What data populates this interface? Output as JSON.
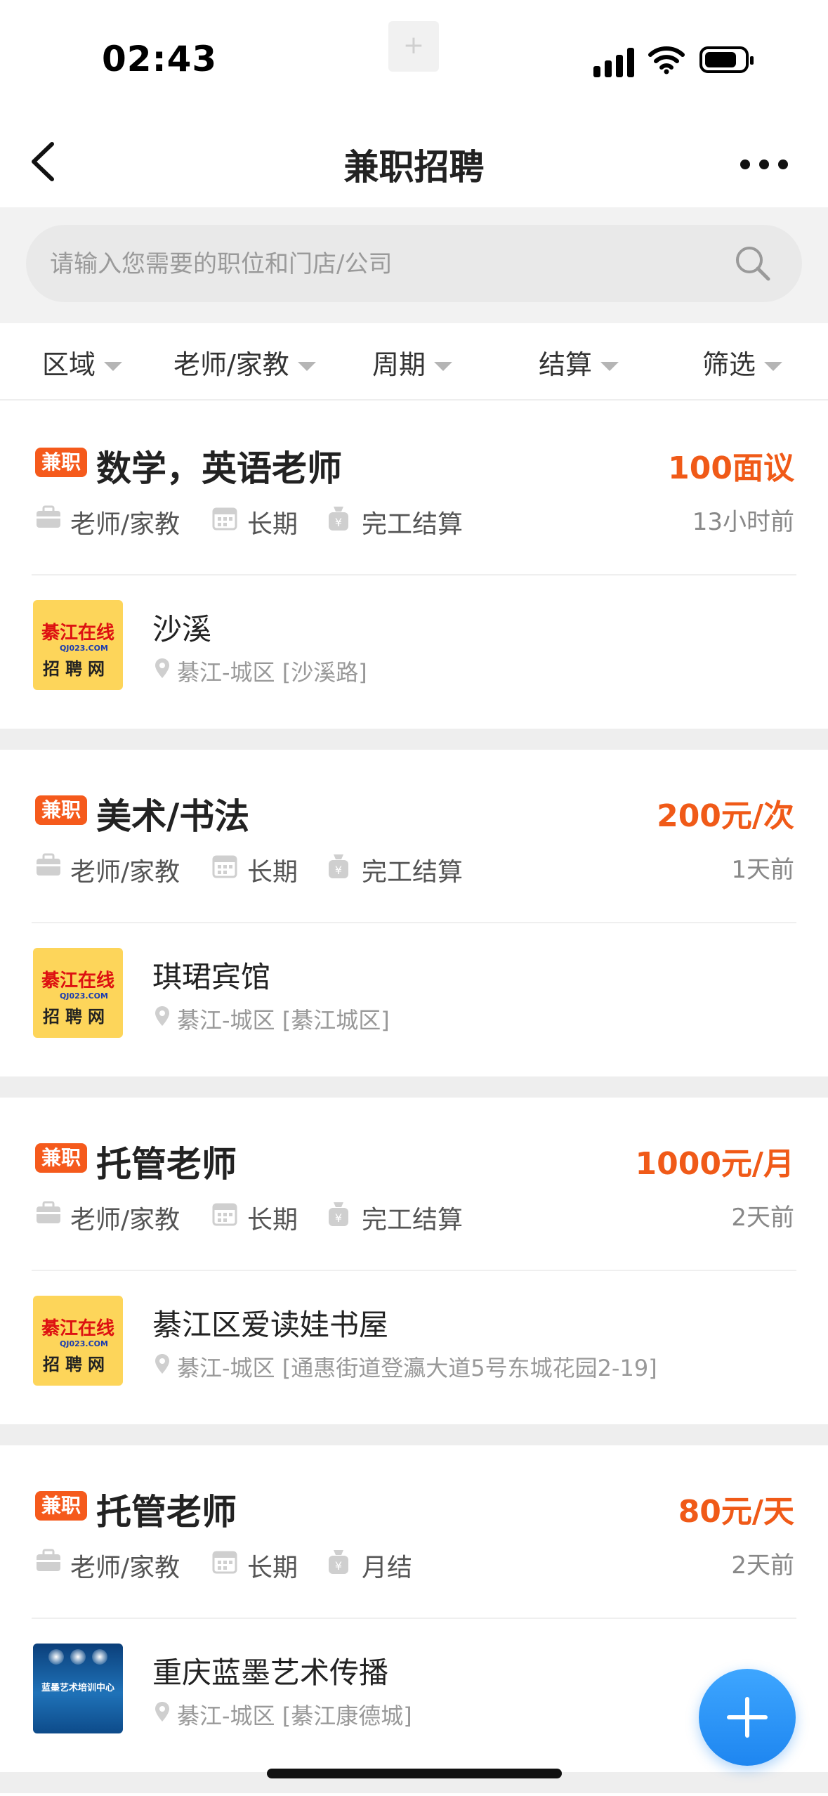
{
  "status_bar": {
    "time": "02:43"
  },
  "nav": {
    "title": "兼职招聘"
  },
  "search": {
    "placeholder": "请输入您需要的职位和门店/公司"
  },
  "filters": [
    "区域",
    "老师/家教",
    "周期",
    "结算",
    "筛选"
  ],
  "jobs": [
    {
      "tag": "兼职",
      "title": "数学，英语老师",
      "salary": "100面议",
      "category": "老师/家教",
      "period": "长期",
      "settlement": "完工结算",
      "time_ago": "13小时前",
      "company": "沙溪",
      "address": "綦江-城区 [沙溪路]",
      "logo": "qj-logo"
    },
    {
      "tag": "兼职",
      "title": "美术/书法",
      "salary": "200元/次",
      "category": "老师/家教",
      "period": "长期",
      "settlement": "完工结算",
      "time_ago": "1天前",
      "company": "琪珺宾馆",
      "address": "綦江-城区 [綦江城区]",
      "logo": "qj-logo"
    },
    {
      "tag": "兼职",
      "title": "托管老师",
      "salary": "1000元/月",
      "category": "老师/家教",
      "period": "长期",
      "settlement": "完工结算",
      "time_ago": "2天前",
      "company": "綦江区爱读娃书屋",
      "address": "綦江-城区 [通惠街道登瀛大道5号东城花园2-19]",
      "logo": "qj-logo"
    },
    {
      "tag": "兼职",
      "title": "托管老师",
      "salary": "80元/天",
      "category": "老师/家教",
      "period": "长期",
      "settlement": "月结",
      "time_ago": "2天前",
      "company": "重庆蓝墨艺术传播",
      "address": "綦江-城区 [綦江康德城]",
      "logo": "lanmo-logo"
    }
  ],
  "logo_texts": {
    "qj_line1": "綦江在线",
    "qj_domain": "QJ023.COM",
    "qj_line2": "招聘网",
    "lanmo": "蓝墨艺术培训中心"
  },
  "colors": {
    "accent": "#f05a18",
    "tag_bg": "#f55a1c",
    "fab": "#1e86f0"
  }
}
